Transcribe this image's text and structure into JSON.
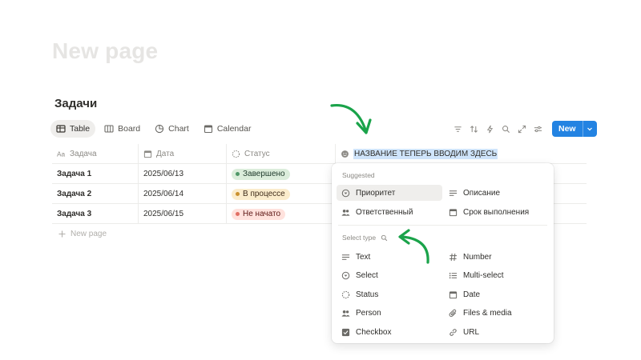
{
  "page": {
    "title": "New page"
  },
  "database": {
    "title": "Задачи",
    "views": [
      {
        "label": "Table",
        "icon": "table-icon"
      },
      {
        "label": "Board",
        "icon": "board-icon"
      },
      {
        "label": "Chart",
        "icon": "chart-icon"
      },
      {
        "label": "Calendar",
        "icon": "calendar-icon"
      }
    ],
    "new_button_label": "New",
    "columns": [
      {
        "label": "Задача",
        "icon": "text-aa-icon"
      },
      {
        "label": "Дата",
        "icon": "calendar-icon"
      },
      {
        "label": "Статус",
        "icon": "status-icon"
      }
    ],
    "new_property_input": "НАЗВАНИЕ ТЕПЕРЬ ВВОДИМ ЗДЕСЬ",
    "rows": [
      {
        "name": "Задача 1",
        "date": "2025/06/13",
        "status": "Завершено"
      },
      {
        "name": "Задача 2",
        "date": "2025/06/14",
        "status": "В процессе"
      },
      {
        "name": "Задача 3",
        "date": "2025/06/15",
        "status": "Не начато"
      }
    ],
    "new_row_label": "New page"
  },
  "menu": {
    "suggested_label": "Suggested",
    "suggested": [
      {
        "label": "Приоритет",
        "icon": "select-icon"
      },
      {
        "label": "Описание",
        "icon": "text-icon"
      },
      {
        "label": "Ответственный",
        "icon": "person-icon"
      },
      {
        "label": "Срок выполнения",
        "icon": "calendar-icon"
      }
    ],
    "select_type_label": "Select type",
    "types": [
      {
        "label": "Text",
        "icon": "text-icon"
      },
      {
        "label": "Number",
        "icon": "number-icon"
      },
      {
        "label": "Select",
        "icon": "select-icon"
      },
      {
        "label": "Multi-select",
        "icon": "multi-select-icon"
      },
      {
        "label": "Status",
        "icon": "status-icon"
      },
      {
        "label": "Date",
        "icon": "calendar-icon"
      },
      {
        "label": "Person",
        "icon": "person-icon"
      },
      {
        "label": "Files & media",
        "icon": "paperclip-icon"
      },
      {
        "label": "Checkbox",
        "icon": "checkbox-icon"
      },
      {
        "label": "URL",
        "icon": "link-icon"
      }
    ]
  },
  "colors": {
    "accent": "#2383e2",
    "annotation_arrow": "#1aa34a",
    "status_done": "#dbeddb",
    "status_progress": "#fbeccc",
    "status_todo": "#ffe2dd"
  }
}
